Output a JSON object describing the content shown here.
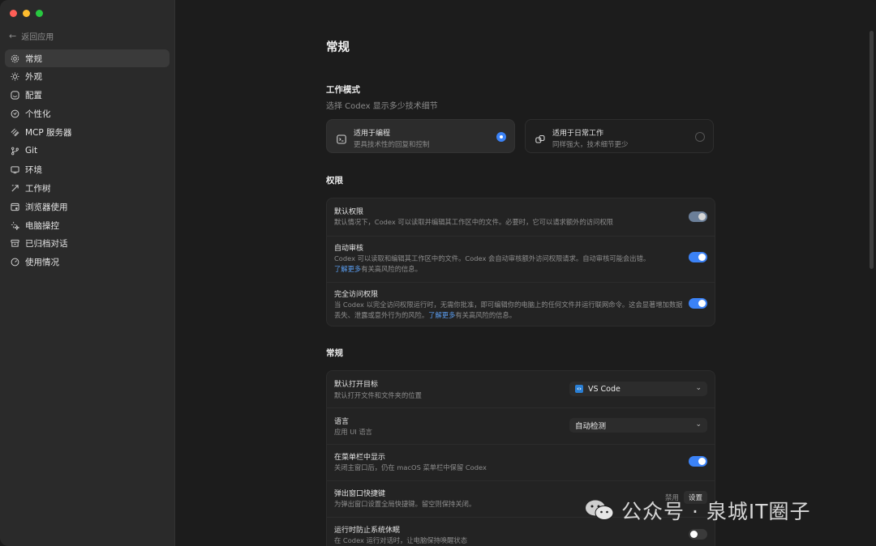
{
  "sidebar": {
    "back_label": "返回应用",
    "items": [
      {
        "label": "常规",
        "icon": "gear-icon",
        "active": true
      },
      {
        "label": "外观",
        "icon": "sun-icon",
        "active": false
      },
      {
        "label": "配置",
        "icon": "config-icon",
        "active": false
      },
      {
        "label": "个性化",
        "icon": "personalize-icon",
        "active": false
      },
      {
        "label": "MCP 服务器",
        "icon": "mcp-icon",
        "active": false
      },
      {
        "label": "Git",
        "icon": "git-branch-icon",
        "active": false
      },
      {
        "label": "环境",
        "icon": "monitor-icon",
        "active": false
      },
      {
        "label": "工作树",
        "icon": "worktree-icon",
        "active": false
      },
      {
        "label": "浏览器使用",
        "icon": "browser-icon",
        "active": false
      },
      {
        "label": "电脑操控",
        "icon": "sparkle-icon",
        "active": false
      },
      {
        "label": "已归档对话",
        "icon": "archive-icon",
        "active": false
      },
      {
        "label": "使用情况",
        "icon": "gauge-icon",
        "active": false
      }
    ]
  },
  "main": {
    "title": "常规",
    "work_mode": {
      "title": "工作模式",
      "subtitle": "选择 Codex 显示多少技术细节",
      "options": [
        {
          "title": "适用于编程",
          "desc": "更具技术性的回复和控制",
          "selected": true,
          "icon": "terminal-icon"
        },
        {
          "title": "适用于日常工作",
          "desc": "同样强大，技术细节更少",
          "selected": false,
          "icon": "link-icon"
        }
      ]
    },
    "permissions": {
      "title": "权限",
      "rows": [
        {
          "title": "默认权限",
          "desc": "默认情况下，Codex 可以读取并编辑其工作区中的文件。必要时，它可以请求额外的访问权限",
          "toggle": "on-dim"
        },
        {
          "title": "自动审核",
          "desc": "Codex 可以读取和编辑其工作区中的文件。Codex 会自动审核额外访问权限请求。自动审核可能会出错。",
          "link": "了解更多",
          "link_suffix": "有关高风险的信息。",
          "toggle": "on"
        },
        {
          "title": "完全访问权限",
          "desc": "当 Codex 以完全访问权限运行时，无需你批准，即可编辑你的电脑上的任何文件并运行联网命令。这会显著增加数据丢失、泄露或意外行为的风险。",
          "link": "了解更多",
          "link_suffix": "有关高风险的信息。",
          "toggle": "on"
        }
      ]
    },
    "general": {
      "title": "常规",
      "rows": [
        {
          "title": "默认打开目标",
          "desc": "默认打开文件和文件夹的位置",
          "select": "VS Code"
        },
        {
          "title": "语言",
          "desc": "应用 UI 语言",
          "select": "自动检测"
        },
        {
          "title": "在菜单栏中显示",
          "desc": "关闭主窗口后，仍在 macOS 菜单栏中保留 Codex",
          "toggle": "on"
        },
        {
          "title": "弹出窗口快捷键",
          "desc": "为弹出窗口设置全局快捷键。留空则保持关闭。",
          "status": "禁用",
          "button": "设置"
        },
        {
          "title": "运行时防止系统休眠",
          "desc": "在 Codex 运行对话时，让电脑保持唤醒状态",
          "toggle": "off"
        }
      ]
    }
  },
  "watermark": {
    "text": "公众号 · 泉城IT圈子",
    "icon": "wechat-icon"
  },
  "colors": {
    "accent": "#3b82f6",
    "link": "#5a9df0",
    "background": "#1c1c1c",
    "sidebar": "#2a2a2a"
  }
}
